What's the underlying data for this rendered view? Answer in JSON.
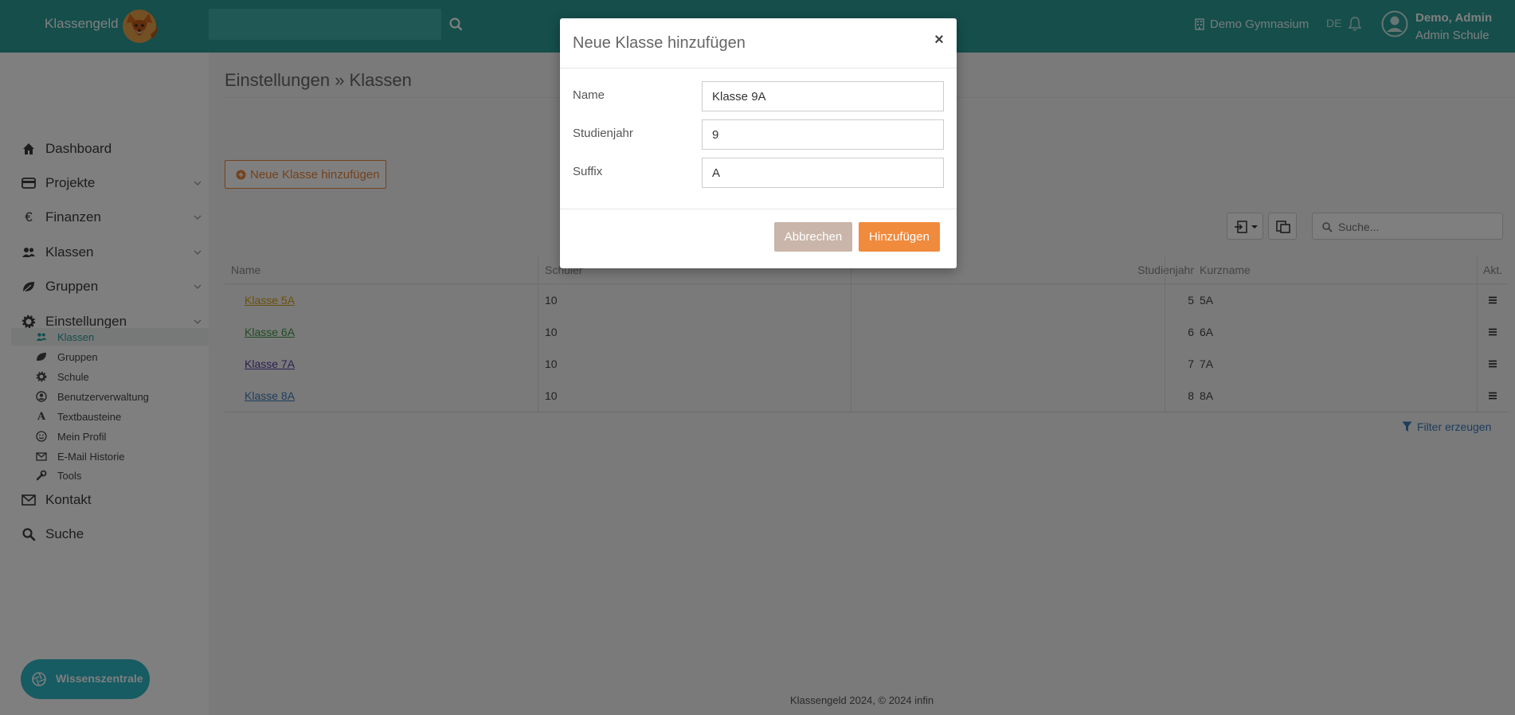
{
  "header": {
    "brand": "Klassengeld",
    "school": "Demo Gymnasium",
    "language": "DE",
    "user_name": "Demo, Admin",
    "user_role": "Admin Schule",
    "search_value": ""
  },
  "sidebar": {
    "items": [
      {
        "label": "Dashboard",
        "icon": "home-icon",
        "has_children": false
      },
      {
        "label": "Projekte",
        "icon": "credit-card-icon",
        "has_children": true
      },
      {
        "label": "Finanzen",
        "icon": "euro-icon",
        "has_children": true
      },
      {
        "label": "Klassen",
        "icon": "users-icon",
        "has_children": true
      },
      {
        "label": "Gruppen",
        "icon": "leaf-icon",
        "has_children": true
      },
      {
        "label": "Einstellungen",
        "icon": "gear-icon",
        "has_children": true
      }
    ],
    "subitems": [
      {
        "label": "Klassen",
        "icon": "users-icon",
        "active": true
      },
      {
        "label": "Gruppen",
        "icon": "leaf-icon",
        "active": false
      },
      {
        "label": "Schule",
        "icon": "gear-icon",
        "active": false
      },
      {
        "label": "Benutzerverwaltung",
        "icon": "user-circle-icon",
        "active": false
      },
      {
        "label": "Textbausteine",
        "icon": "font-icon",
        "active": false
      },
      {
        "label": "Mein Profil",
        "icon": "smile-icon",
        "active": false
      },
      {
        "label": "E-Mail Historie",
        "icon": "envelope-icon",
        "active": false
      },
      {
        "label": "Tools",
        "icon": "wrench-icon",
        "active": false
      }
    ],
    "bottom_items": [
      {
        "label": "Kontakt",
        "icon": "envelope-icon"
      },
      {
        "label": "Suche",
        "icon": "search-icon"
      }
    ],
    "knowledge_button": "Wissenszentrale"
  },
  "main": {
    "title": "Einstellungen » Klassen",
    "add_button": "Neue Klasse hinzufügen",
    "search_placeholder": "Suche...",
    "columns": [
      "Name",
      "Schüler",
      "Studienjahr",
      "Kurzname",
      "Akt."
    ],
    "rows": [
      {
        "name": "Klasse 5A",
        "students": "10",
        "year": "5",
        "short": "5A",
        "color": "#d4a017"
      },
      {
        "name": "Klasse 6A",
        "students": "10",
        "year": "6",
        "short": "6A",
        "color": "#3a9a4a"
      },
      {
        "name": "Klasse 7A",
        "students": "10",
        "year": "7",
        "short": "7A",
        "color": "#5b3fa6"
      },
      {
        "name": "Klasse 8A",
        "students": "10",
        "year": "8",
        "short": "8A",
        "color": "#3a7bbf"
      }
    ],
    "filter_link": "Filter erzeugen",
    "footer": "Klassengeld 2024, © 2024 infin"
  },
  "modal": {
    "title": "Neue Klasse hinzufügen",
    "close": "×",
    "fields": [
      {
        "label": "Name",
        "value": "Klasse 9A"
      },
      {
        "label": "Studienjahr",
        "value": "9"
      },
      {
        "label": "Suffix",
        "value": "A"
      }
    ],
    "cancel": "Abbrechen",
    "submit": "Hinzufügen"
  },
  "colors": {
    "brand_teal": "#2a9d96",
    "accent_orange": "#f08a3c",
    "cancel_beige": "#c9b5a9",
    "knowledge_button": "#2eb6c6"
  }
}
